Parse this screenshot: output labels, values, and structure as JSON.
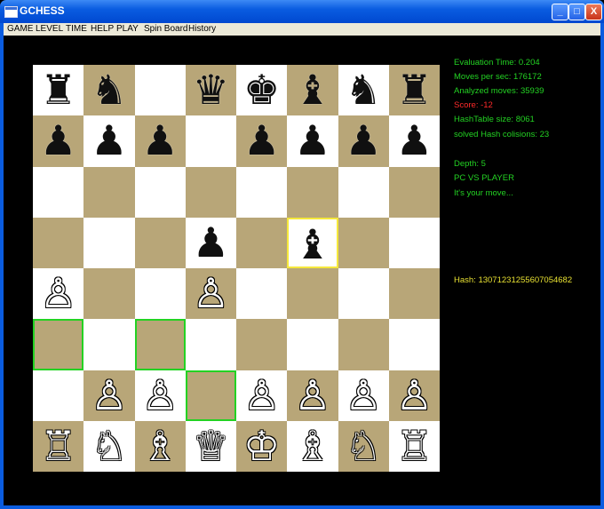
{
  "window": {
    "title": "GCHESS",
    "minimize_label": "_",
    "maximize_label": "□",
    "close_label": "X"
  },
  "menu": [
    {
      "label": "GAME"
    },
    {
      "label": "LEVEL"
    },
    {
      "label": "TIME"
    },
    {
      "label": "HELP"
    },
    {
      "label": "PLAY"
    },
    {
      "label": "Spin Board"
    },
    {
      "label": "History"
    }
  ],
  "board": {
    "rows": [
      [
        "r",
        "n",
        "",
        "q",
        "k",
        "b",
        "n",
        "r"
      ],
      [
        "p",
        "p",
        "p",
        "",
        "p",
        "p",
        "p",
        "p"
      ],
      [
        "",
        "",
        "",
        "",
        "",
        "",
        "",
        ""
      ],
      [
        "",
        "",
        "",
        "p",
        "",
        "b",
        "",
        ""
      ],
      [
        "P",
        "",
        "",
        "P",
        "",
        "",
        "",
        ""
      ],
      [
        "",
        "",
        "",
        "",
        "",
        "",
        "",
        ""
      ],
      [
        "",
        "P",
        "P",
        "",
        "P",
        "P",
        "P",
        "P"
      ],
      [
        "R",
        "N",
        "B",
        "Q",
        "K",
        "B",
        "N",
        "R"
      ]
    ],
    "glyphs": {
      "K": "♔",
      "Q": "♕",
      "R": "♖",
      "B": "♗",
      "N": "♘",
      "P": "♙",
      "k": "♚",
      "q": "♛",
      "r": "♜",
      "b": "♝",
      "n": "♞",
      "p": "♟"
    },
    "highlights": [
      {
        "row": 5,
        "col": 0,
        "color": "green"
      },
      {
        "row": 5,
        "col": 2,
        "color": "green"
      },
      {
        "row": 6,
        "col": 3,
        "color": "green"
      },
      {
        "row": 3,
        "col": 5,
        "color": "yellow"
      }
    ],
    "colors": {
      "light": "#ffffff",
      "dark": "#b8a678",
      "green": "#23d223",
      "yellow": "#f5e83c"
    }
  },
  "info": {
    "evaluation_time": "Evaluation Time: 0.204",
    "moves_per_sec": "Moves per sec: 176172",
    "analyzed_moves": "Analyzed moves: 35939",
    "score": "Score: -12",
    "hashtable_size": "HashTable size: 8061",
    "hash_collisions": "solved Hash colisions: 23",
    "depth": "Depth: 5",
    "mode": "PC VS PLAYER",
    "prompt": "It's your move...",
    "hash": "Hash: 13071231255607054682"
  },
  "colors": {
    "info_text": "#23d223",
    "score_text": "#ff2a2a",
    "hash_text": "#e7e032"
  }
}
